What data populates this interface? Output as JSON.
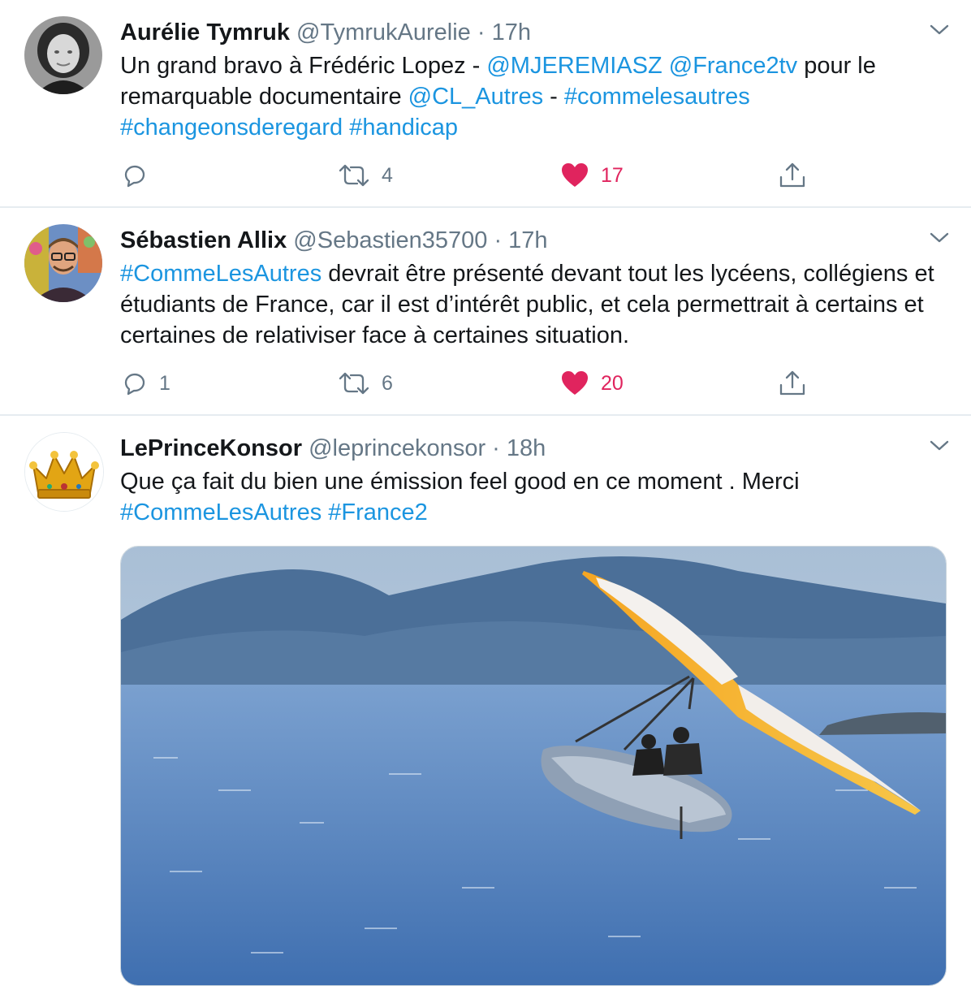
{
  "colors": {
    "link": "#1b95e0",
    "like": "#e0245e",
    "muted": "#657786",
    "divider": "#e6ecf0"
  },
  "tweets": [
    {
      "name": "Aurélie Tymruk",
      "handle": "@TymrukAurelie",
      "dot": "·",
      "time": "17h",
      "avatar_icon": "user-photo-grayscale",
      "text_parts": [
        {
          "t": "Un grand bravo à Frédéric Lopez - ",
          "link": false
        },
        {
          "t": "@MJEREMIASZ",
          "link": true
        },
        {
          "t": " ",
          "link": false
        },
        {
          "t": "@France2tv",
          "link": true
        },
        {
          "t": " pour le remarquable documentaire ",
          "link": false
        },
        {
          "t": "@CL_Autres",
          "link": true
        },
        {
          "t": " - ",
          "link": false
        },
        {
          "t": "#commelesautres",
          "link": true
        },
        {
          "t": " ",
          "link": false
        },
        {
          "t": "#changeonsderegard",
          "link": true
        },
        {
          "t": " ",
          "link": false
        },
        {
          "t": "#handicap",
          "link": true
        }
      ],
      "replies": "",
      "retweets": "4",
      "likes": "17",
      "liked": true
    },
    {
      "name": "Sébastien Allix",
      "handle": "@Sebastien35700",
      "dot": "·",
      "time": "17h",
      "avatar_icon": "user-photo-glasses",
      "text_parts": [
        {
          "t": "#CommeLesAutres",
          "link": true
        },
        {
          "t": " devrait être présenté devant tout les lycéens, collégiens et étudiants de France, car il est d’intérêt public, et cela permettrait à certains et certaines de relativiser face à certaines situation.",
          "link": false
        }
      ],
      "replies": "1",
      "retweets": "6",
      "likes": "20",
      "liked": true
    },
    {
      "name": "LePrinceKonsor",
      "handle": "@leprincekonsor",
      "dot": "·",
      "time": "18h",
      "avatar_icon": "crown-icon",
      "text_parts": [
        {
          "t": "Que ça fait du bien une émission feel good en ce moment . Merci ",
          "link": false
        },
        {
          "t": "#CommeLesAutres",
          "link": true
        },
        {
          "t": " ",
          "link": false
        },
        {
          "t": "#France2",
          "link": true
        }
      ],
      "media": "photo-flying-inflatable-boat-over-lake"
    }
  ]
}
